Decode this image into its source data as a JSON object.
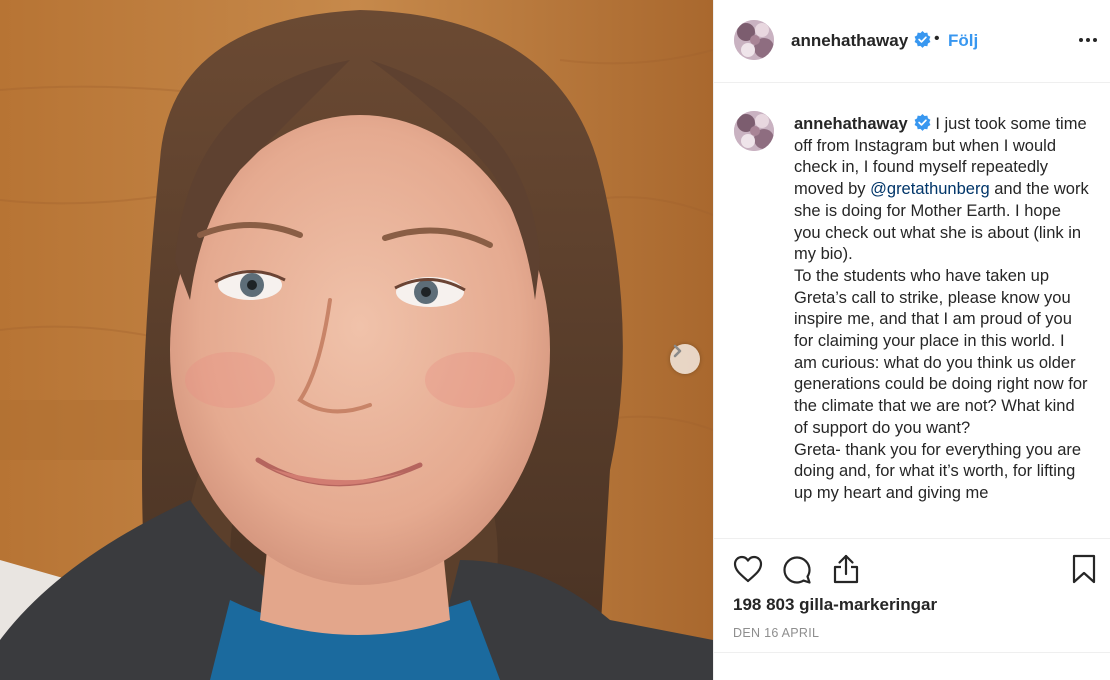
{
  "header": {
    "username": "annehathaway",
    "separator": "•",
    "follow_label": "Följ",
    "more_icon": "more-horizontal-icon"
  },
  "caption": {
    "username": "annehathaway",
    "text_before_mention": "I just took some time off from Instagram but when I would check in, I found myself repeatedly moved by",
    "mention": "@gretathunberg",
    "text_after_mention": "and the work she is doing for Mother Earth. I hope you check out what she is about (link in my bio).\nTo the students who have taken up Greta’s call to strike, please know you inspire me, and that I am proud of you for claiming your place in this world. I am curious: what do you think us older generations could be doing right now for the climate that we are not? What kind of support do you want?\nGreta- thank you for everything you are doing and, for what it’s worth, for lifting up my heart and giving me"
  },
  "actions": {
    "like_icon": "heart-icon",
    "comment_icon": "comment-icon",
    "share_icon": "share-icon",
    "save_icon": "bookmark-icon"
  },
  "likes_text": "198 803 gilla-markeringar",
  "date_text": "DEN 16 APRIL",
  "colors": {
    "link_blue": "#3897f0",
    "mention_blue": "#003569",
    "verified_blue": "#3897f0",
    "text": "#262626",
    "muted": "#8e8e8e",
    "divider": "#efefef"
  }
}
